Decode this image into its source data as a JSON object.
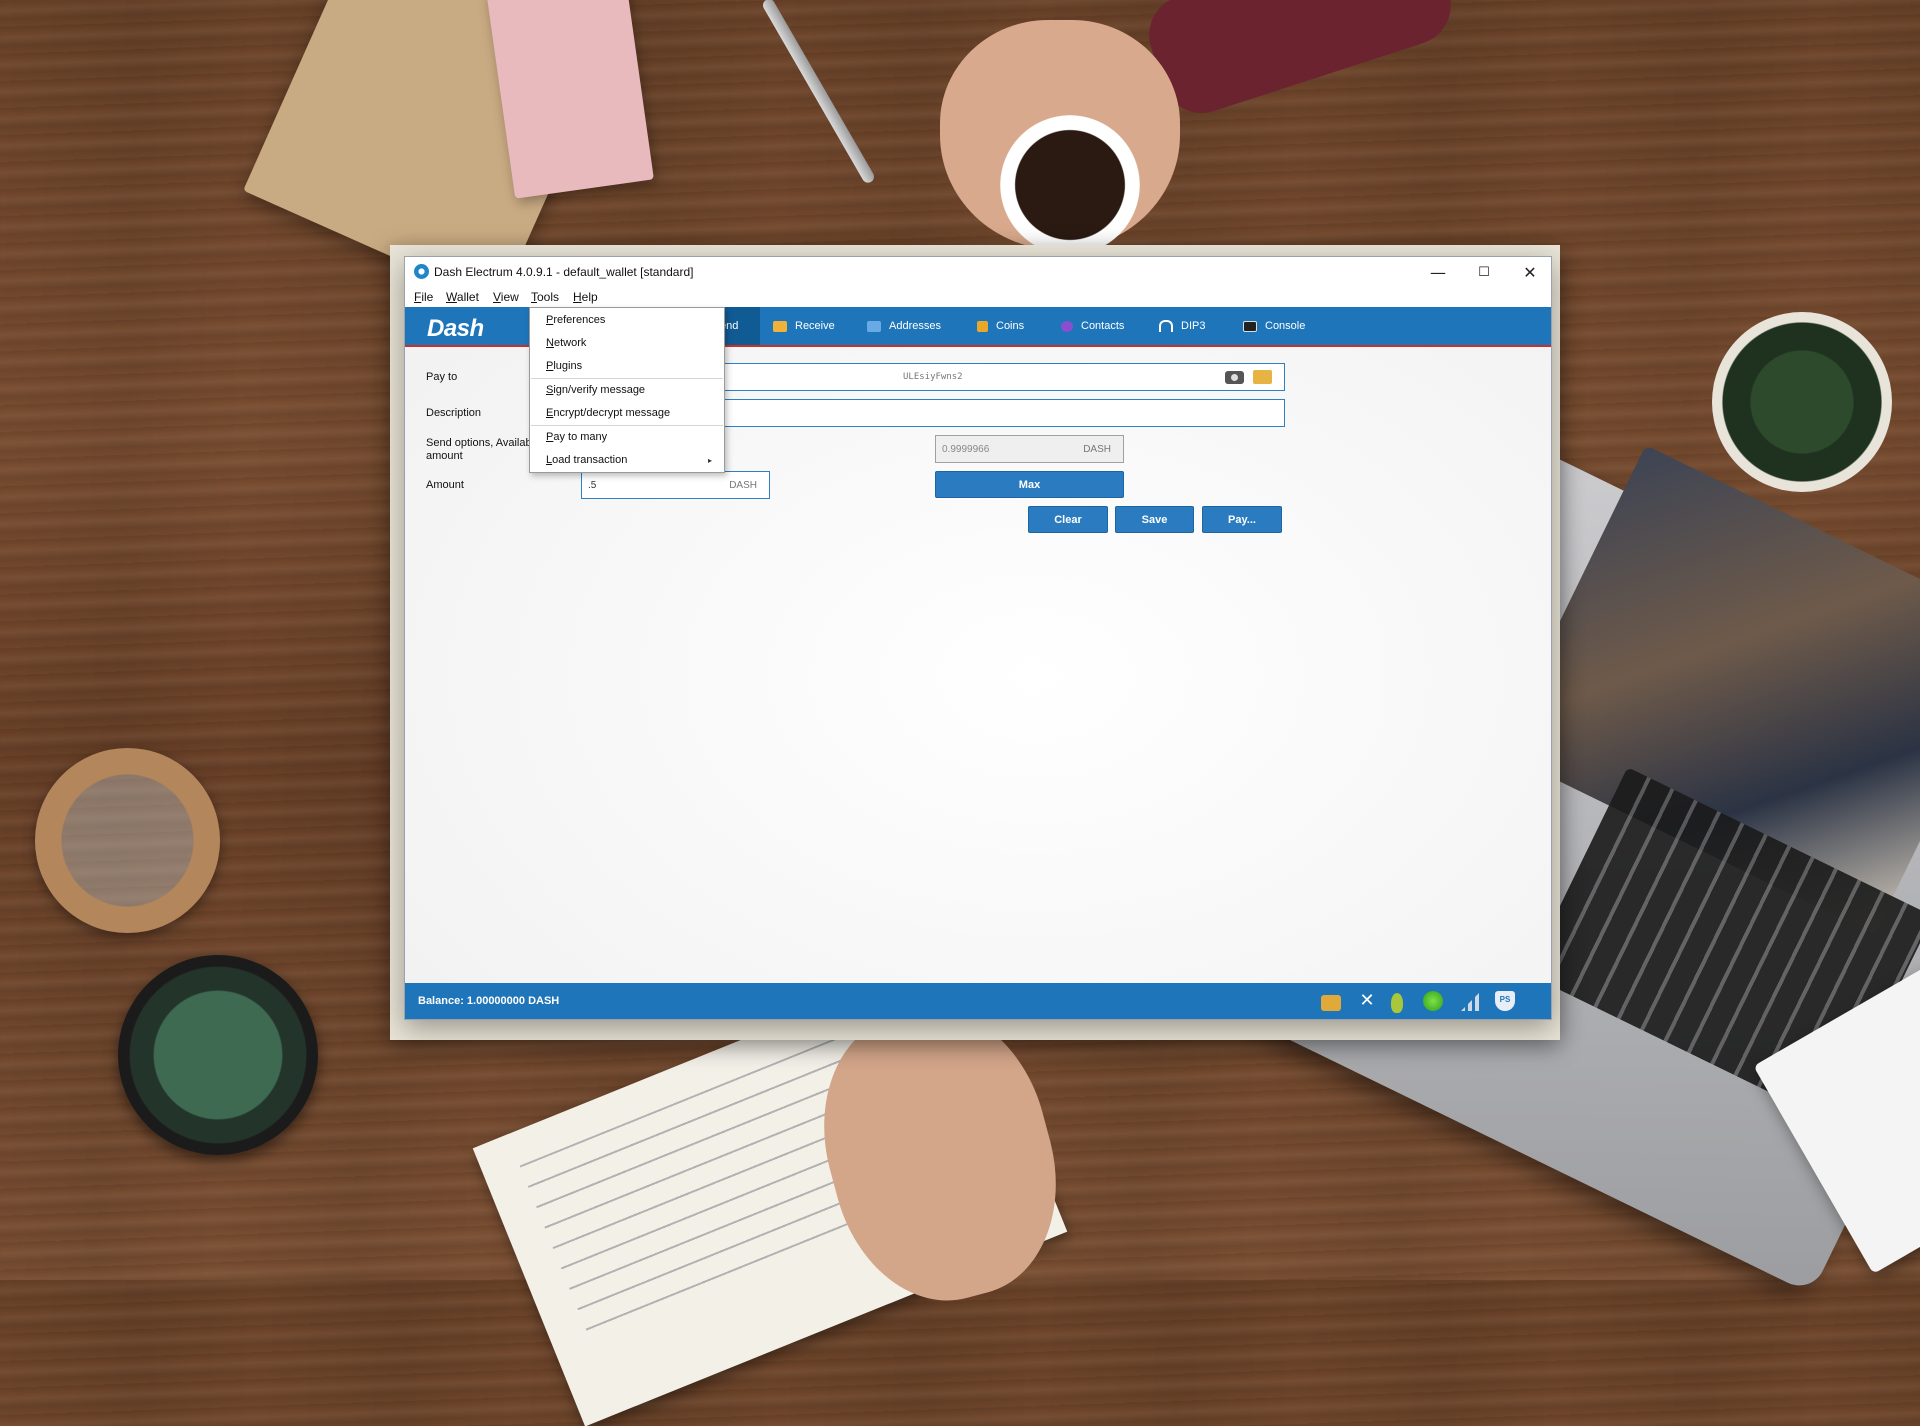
{
  "window": {
    "title": "Dash Electrum 4.0.9.1  -  default_wallet  [standard]",
    "minimize_glyph": "—",
    "maximize_glyph": "☐",
    "close_glyph": "✕"
  },
  "menubar": [
    "File",
    "Wallet",
    "View",
    "Tools",
    "Help"
  ],
  "logo": "Dash",
  "tabs": [
    {
      "label": "end",
      "active": true
    },
    {
      "label": "Receive",
      "icon": "receive-icon",
      "color": "#f0b23a"
    },
    {
      "label": "Addresses",
      "icon": "addresses-icon",
      "color": "#69a9e6"
    },
    {
      "label": "Coins",
      "icon": "coins-icon",
      "color": "#e9a72b"
    },
    {
      "label": "Contacts",
      "icon": "contacts-icon",
      "color": "#8a4fd0"
    },
    {
      "label": "DIP3",
      "icon": "dip3-icon",
      "color": "#ffffff"
    },
    {
      "label": "Console",
      "icon": "console-icon",
      "color": "#222222"
    }
  ],
  "form": {
    "pay_to_label": "Pay to",
    "pay_to_value": "ULEsiyFwns2",
    "description_label": "Description",
    "description_value": "",
    "send_options_label": "Send options, Availab",
    "send_options_label2": "amount",
    "amount_label": "Amount",
    "amount_value": ".5",
    "amount_unit": "DASH",
    "available_value": "0.9999966",
    "available_unit": "DASH"
  },
  "buttons": {
    "max": "Max",
    "clear": "Clear",
    "save": "Save",
    "pay": "Pay..."
  },
  "tools_menu": {
    "items": [
      "Preferences",
      "Network",
      "Plugins",
      "Sign/verify message",
      "Encrypt/decrypt message",
      "Pay to many",
      "Load transaction"
    ],
    "submenu_arrow": "▸"
  },
  "status": {
    "balance": "Balance: 1.00000000 DASH",
    "icons": [
      "lock-icon",
      "tools-icon",
      "seed-icon",
      "network-status-icon",
      "signal-icon",
      "privatesend-icon"
    ],
    "ps_text": "PS",
    "accent": "#1f75b9"
  }
}
